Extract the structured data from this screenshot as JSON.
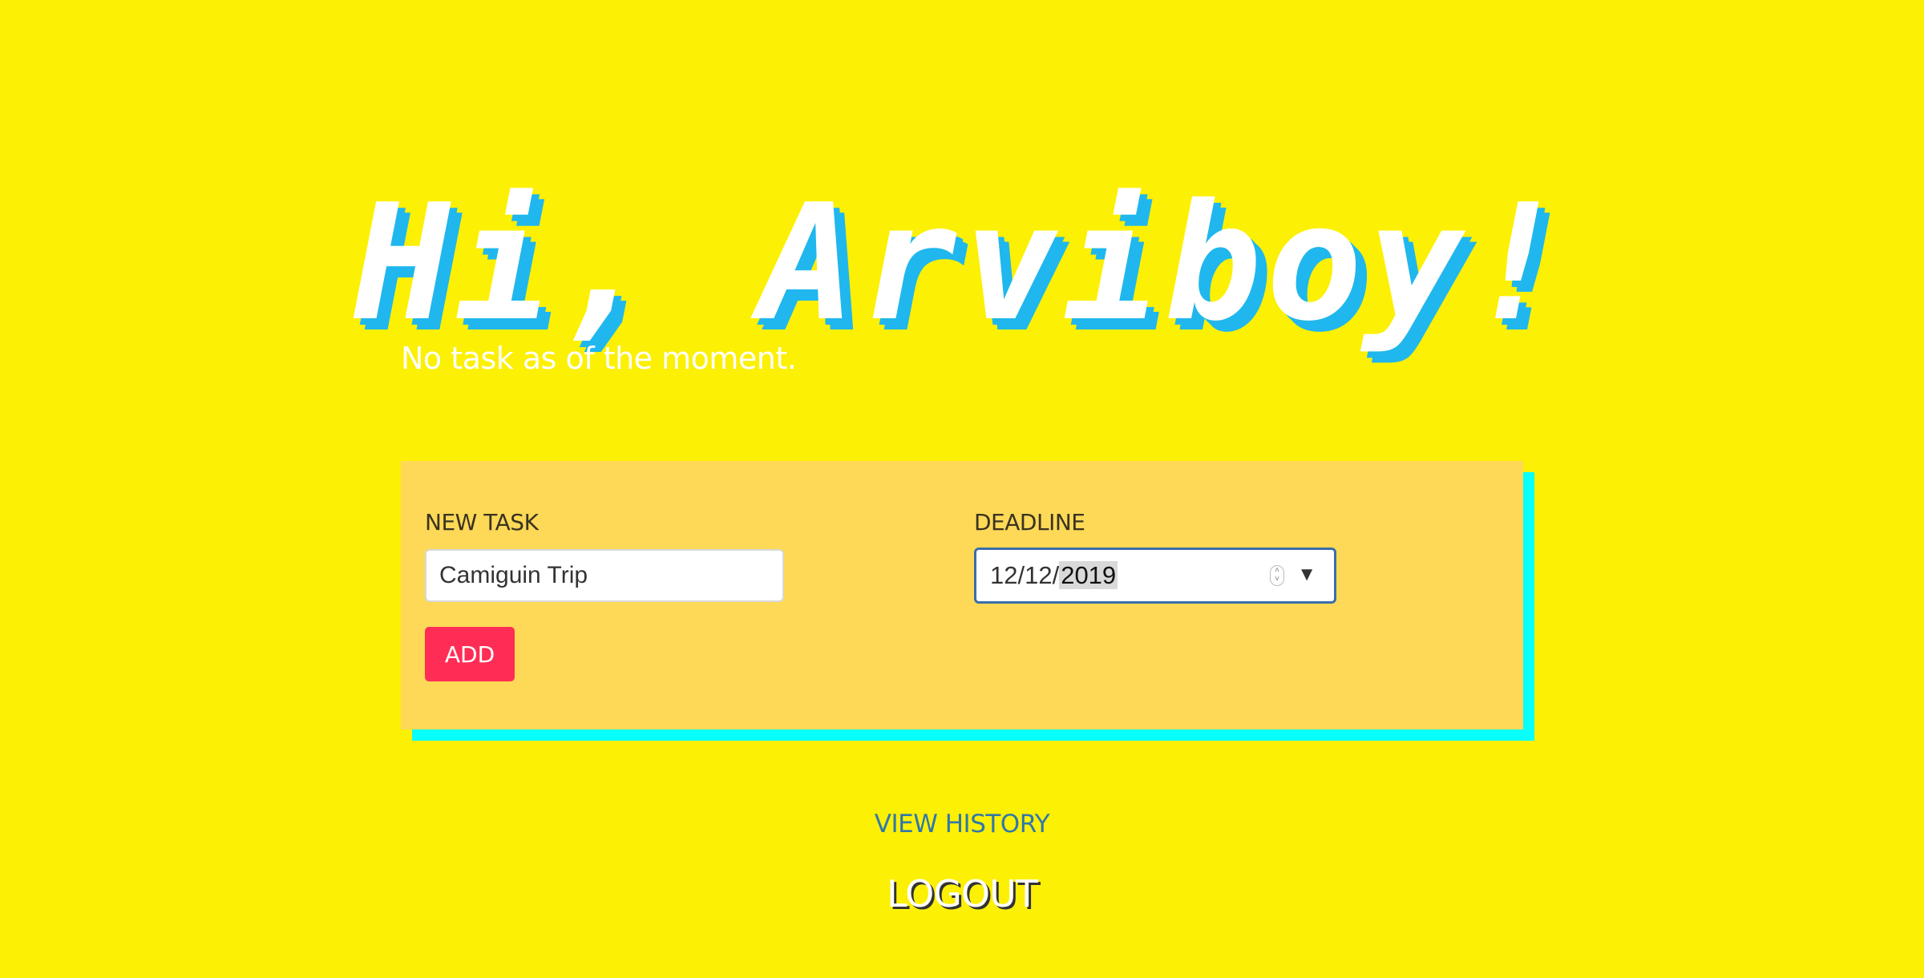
{
  "header": {
    "greeting": "Hi, Arviboy!"
  },
  "tasks": {
    "empty_message": "No task as of the moment."
  },
  "form": {
    "task_label": "NEW TASK",
    "task_value": "Camiguin Trip",
    "deadline_label": "DEADLINE",
    "deadline_month_day": "12/12/",
    "deadline_year": "2019",
    "add_label": "ADD"
  },
  "footer": {
    "history_label": "VIEW HISTORY",
    "logout_label": "LOGOUT"
  },
  "colors": {
    "background": "#fcf005",
    "card": "#fdd957",
    "card_shadow": "#08fffb",
    "greeting_shadow": "#1fb7ee",
    "add_button": "#ff2d55",
    "history_link": "#3178a8"
  }
}
